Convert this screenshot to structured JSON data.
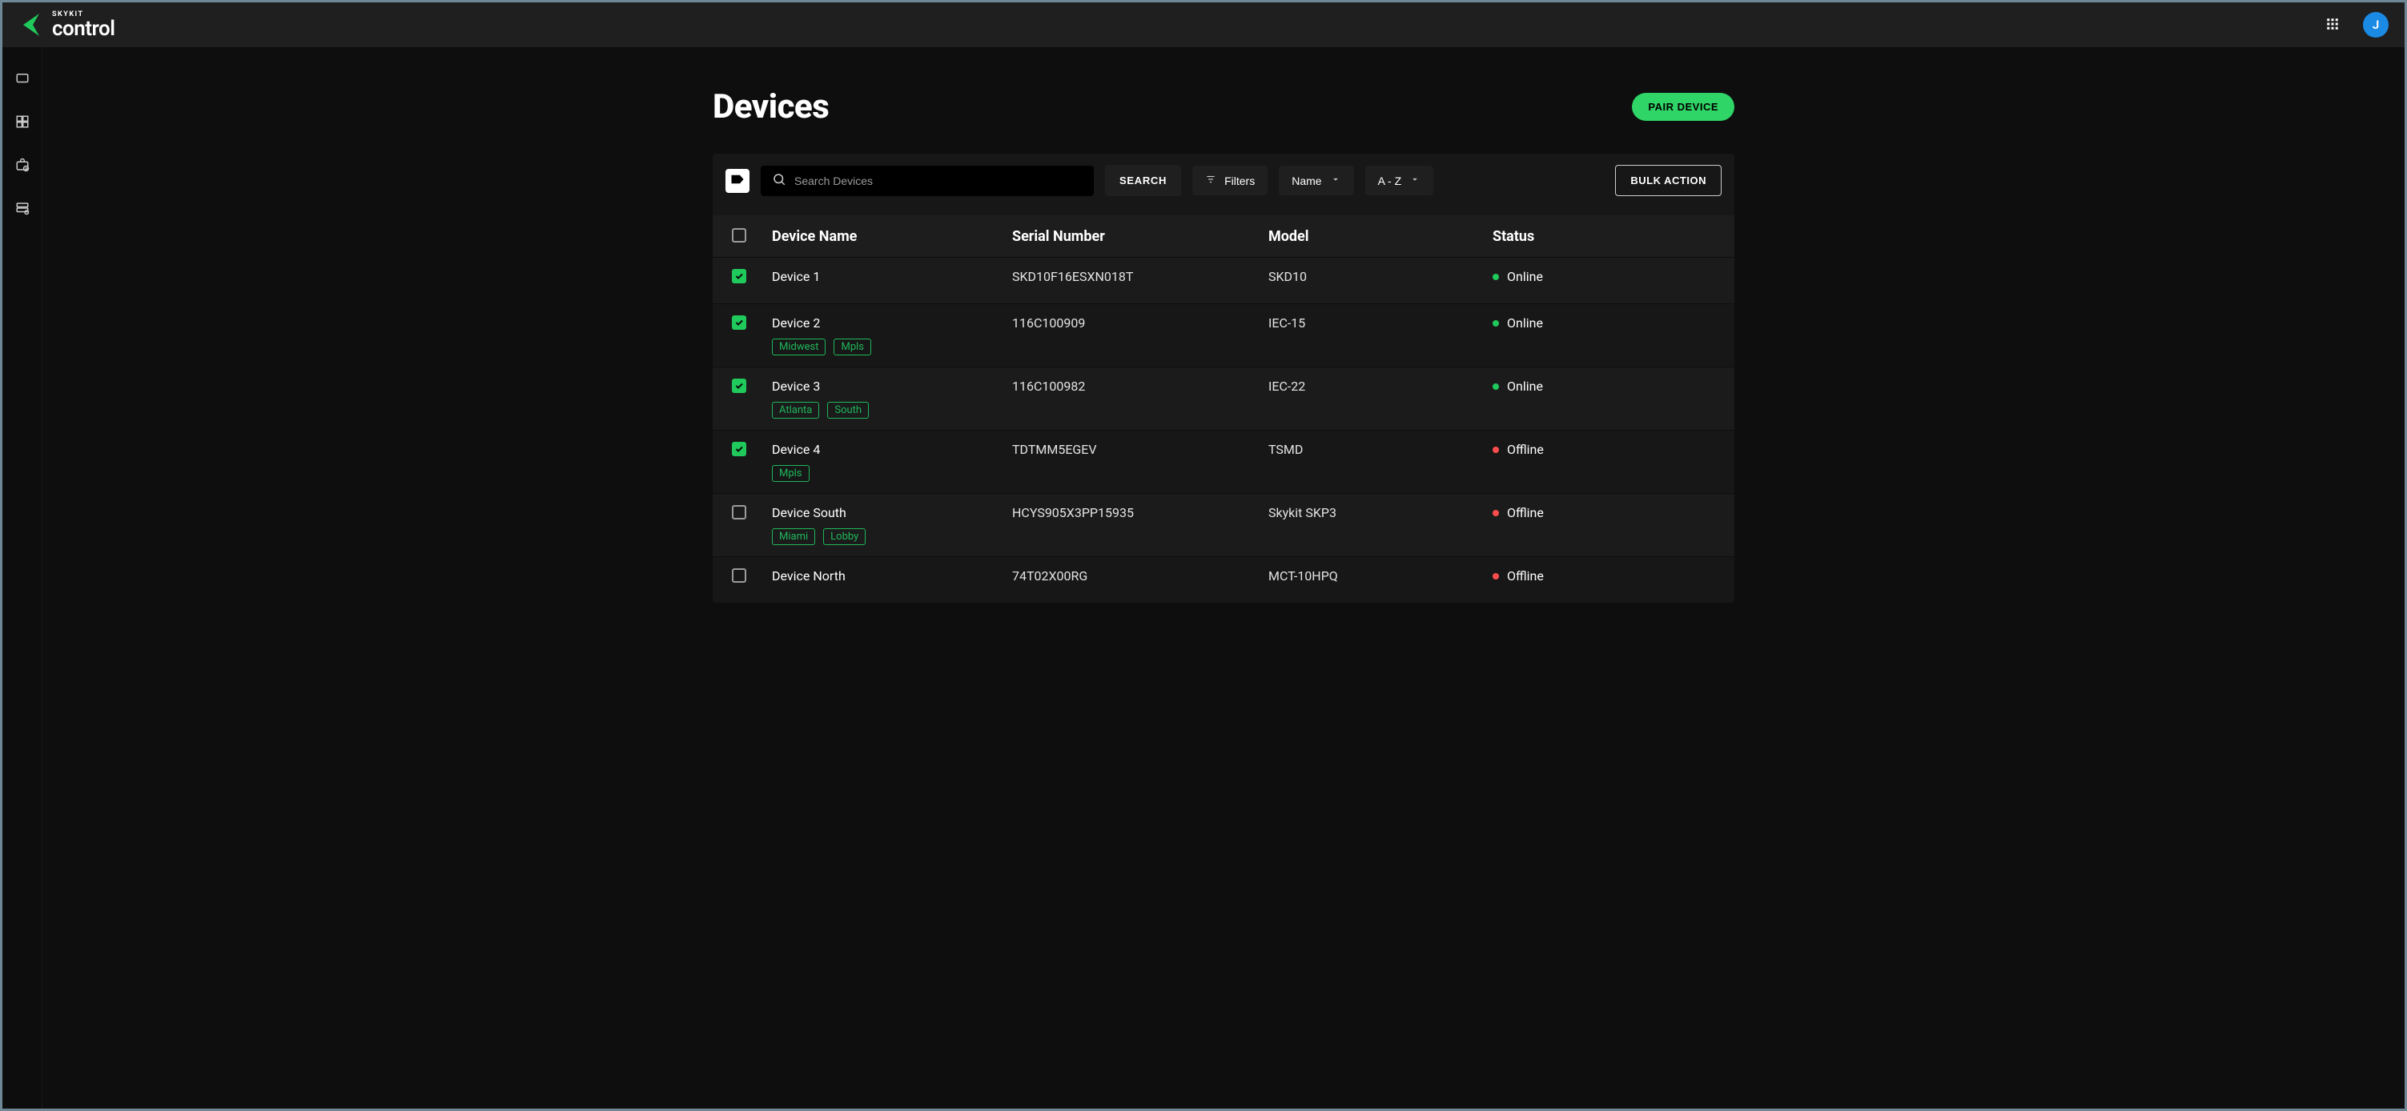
{
  "brand": {
    "kicker": "SKYKIT",
    "name": "control"
  },
  "avatar_initial": "J",
  "page": {
    "title": "Devices",
    "pair_button": "PAIR DEVICE"
  },
  "toolbar": {
    "search_placeholder": "Search Devices",
    "search_button": "SEARCH",
    "filters_label": "Filters",
    "sort_field": "Name",
    "sort_order": "A - Z",
    "bulk_button": "BULK ACTION"
  },
  "table": {
    "headers": {
      "name": "Device Name",
      "serial": "Serial Number",
      "model": "Model",
      "status": "Status"
    },
    "status_colors": {
      "online": "#20c95b",
      "offline": "#ff4d4d"
    },
    "rows": [
      {
        "checked": true,
        "name": "Device 1",
        "tags": [],
        "serial": "SKD10F16ESXN018T",
        "model": "SKD10",
        "status": "Online",
        "status_kind": "online"
      },
      {
        "checked": true,
        "name": "Device 2",
        "tags": [
          "Midwest",
          "Mpls"
        ],
        "serial": "116C100909",
        "model": "IEC-15",
        "status": "Online",
        "status_kind": "online"
      },
      {
        "checked": true,
        "name": "Device 3",
        "tags": [
          "Atlanta",
          "South"
        ],
        "serial": "116C100982",
        "model": "IEC-22",
        "status": "Online",
        "status_kind": "online"
      },
      {
        "checked": true,
        "name": "Device 4",
        "tags": [
          "Mpls"
        ],
        "serial": "TDTMM5EGEV",
        "model": "TSMD",
        "status": "Offline",
        "status_kind": "offline"
      },
      {
        "checked": false,
        "name": "Device South",
        "tags": [
          "Miami",
          "Lobby"
        ],
        "serial": "HCYS905X3PP15935",
        "model": "Skykit SKP3",
        "status": "Offline",
        "status_kind": "offline"
      },
      {
        "checked": false,
        "name": "Device North",
        "tags": [],
        "serial": "74T02X00RG",
        "model": "MCT-10HPQ",
        "status": "Offline",
        "status_kind": "offline"
      }
    ]
  }
}
